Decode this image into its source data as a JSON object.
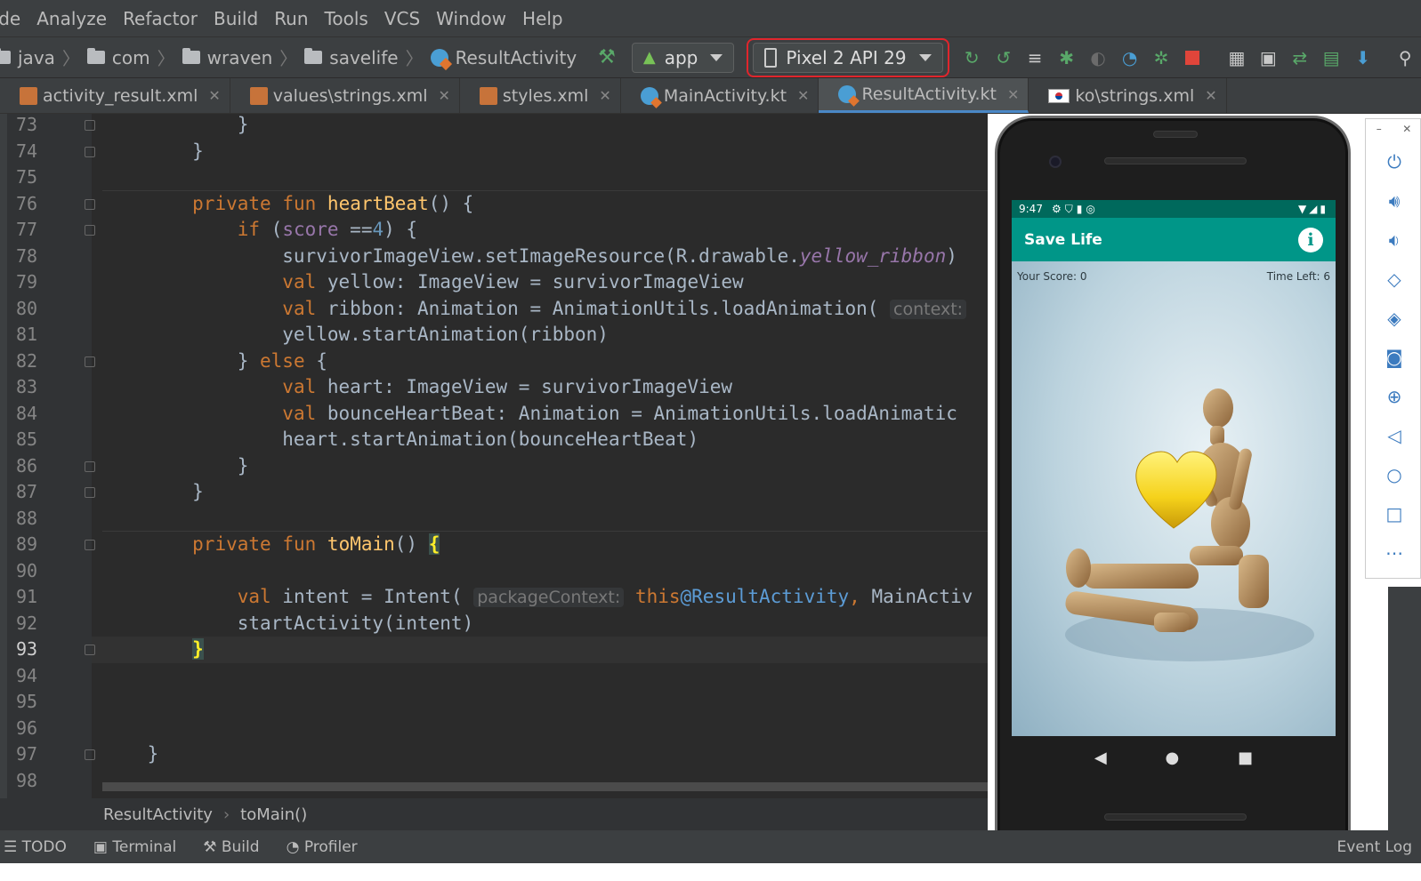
{
  "menu": [
    "ode",
    "Analyze",
    "Refactor",
    "Build",
    "Run",
    "Tools",
    "VCS",
    "Window",
    "Help"
  ],
  "breadcrumbs": [
    "java",
    "com",
    "wraven",
    "savelife",
    "ResultActivity"
  ],
  "toolbar": {
    "module": "app",
    "device": "Pixel 2 API 29"
  },
  "tabs": [
    {
      "label": "activity_result.xml",
      "icon": "xml-file-icon"
    },
    {
      "label": "values\\strings.xml",
      "icon": "xml-file-icon"
    },
    {
      "label": "styles.xml",
      "icon": "xml-file-icon"
    },
    {
      "label": "MainActivity.kt",
      "icon": "kotlin-file-icon"
    },
    {
      "label": "ResultActivity.kt",
      "icon": "kotlin-file-icon",
      "active": true
    },
    {
      "label": "ko\\strings.xml",
      "icon": "korea-flag-icon"
    }
  ],
  "editor": {
    "current_line": 93,
    "lines": [
      {
        "n": "73",
        "t": "            }"
      },
      {
        "n": "74",
        "t": "        }"
      },
      {
        "n": "75",
        "t": ""
      },
      {
        "n": "76",
        "t": "        private fun heartBeat() {"
      },
      {
        "n": "77",
        "t": "            if (score ==4) {"
      },
      {
        "n": "78",
        "t": "                survivorImageView.setImageResource(R.drawable.yellow_ribbon)"
      },
      {
        "n": "79",
        "t": "                val yellow: ImageView = survivorImageView"
      },
      {
        "n": "80",
        "t": "                val ribbon: Animation = AnimationUtils.loadAnimation( context:"
      },
      {
        "n": "81",
        "t": "                yellow.startAnimation(ribbon)"
      },
      {
        "n": "82",
        "t": "            } else {"
      },
      {
        "n": "83",
        "t": "                val heart: ImageView = survivorImageView"
      },
      {
        "n": "84",
        "t": "                val bounceHeartBeat: Animation = AnimationUtils.loadAnimatic"
      },
      {
        "n": "85",
        "t": "                heart.startAnimation(bounceHeartBeat)"
      },
      {
        "n": "86",
        "t": "            }"
      },
      {
        "n": "87",
        "t": "        }"
      },
      {
        "n": "88",
        "t": ""
      },
      {
        "n": "89",
        "t": "        private fun toMain() {"
      },
      {
        "n": "90",
        "t": ""
      },
      {
        "n": "91",
        "t": "            val intent = Intent( packageContext: this@ResultActivity, MainActiv"
      },
      {
        "n": "92",
        "t": "            startActivity(intent)"
      },
      {
        "n": "93",
        "t": "        }"
      },
      {
        "n": "94",
        "t": ""
      },
      {
        "n": "95",
        "t": ""
      },
      {
        "n": "96",
        "t": ""
      },
      {
        "n": "97",
        "t": "    }"
      },
      {
        "n": "98",
        "t": ""
      }
    ]
  },
  "breadcrumb_bar": {
    "class": "ResultActivity",
    "method": "toMain()"
  },
  "statusbar": {
    "todo": "TODO",
    "terminal": "Terminal",
    "build": "Build",
    "profiler": "Profiler",
    "event_log": "Event Log"
  },
  "phone": {
    "time": "9:47",
    "app_title": "Save Life",
    "score": "Your Score: 0",
    "time_left": "Time Left: 6",
    "colors": {
      "status": "#00695c",
      "appbar": "#009688",
      "heart": "#f5d21b"
    }
  },
  "emulator_controls": [
    "power-icon",
    "volume-up-icon",
    "volume-down-icon",
    "rotate-left-icon",
    "rotate-right-icon",
    "screenshot-icon",
    "zoom-icon",
    "back-icon",
    "home-icon",
    "overview-icon",
    "more-icon"
  ]
}
